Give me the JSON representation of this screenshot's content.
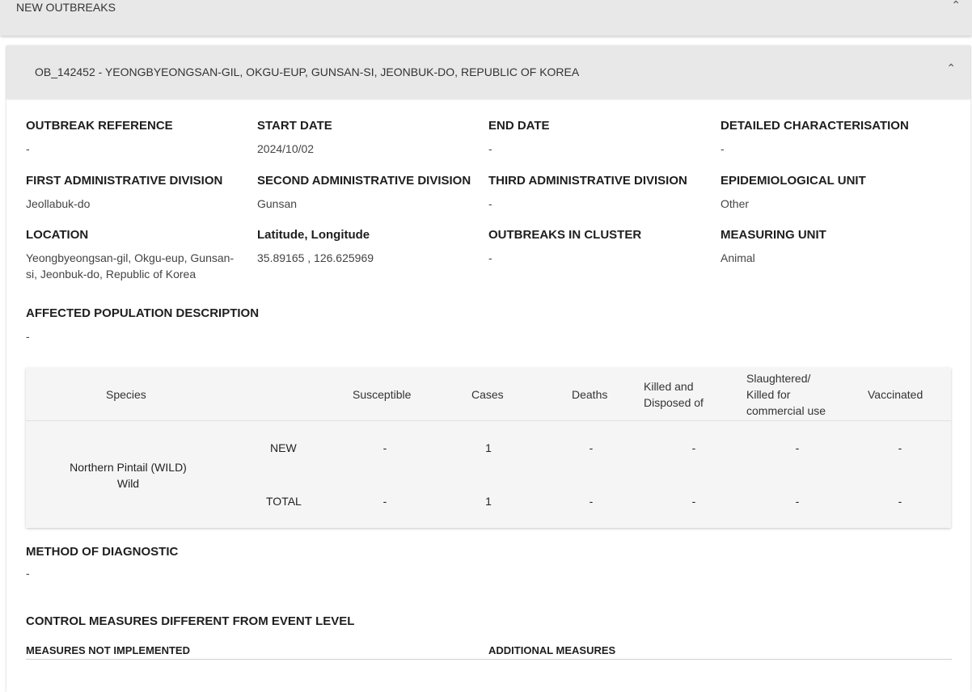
{
  "top_panel": {
    "title": "NEW OUTBREAKS",
    "toggle_icon": "chevron-up-icon"
  },
  "outbreak_panel": {
    "title": "OB_142452 - YEONGBYEONGSAN-GIL, OKGU-EUP, GUNSAN-SI, JEONBUK-DO, REPUBLIC OF KOREA",
    "toggle_icon": "chevron-up-icon"
  },
  "fields": {
    "outbreak_reference": {
      "label": "OUTBREAK REFERENCE",
      "value": "-"
    },
    "start_date": {
      "label": "START DATE",
      "value": "2024/10/02"
    },
    "end_date": {
      "label": "END DATE",
      "value": "-"
    },
    "detailed_characterisation": {
      "label": "DETAILED CHARACTERISATION",
      "value": "-"
    },
    "first_admin_division": {
      "label": "FIRST ADMINISTRATIVE DIVISION",
      "value": "Jeollabuk-do"
    },
    "second_admin_division": {
      "label": "SECOND ADMINISTRATIVE DIVISION",
      "value": "Gunsan"
    },
    "third_admin_division": {
      "label": "THIRD ADMINISTRATIVE DIVISION",
      "value": "-"
    },
    "epidemiological_unit": {
      "label": "EPIDEMIOLOGICAL UNIT",
      "value": "Other"
    },
    "location": {
      "label": "LOCATION",
      "value": "Yeongbyeongsan-gil, Okgu-eup, Gunsan-si, Jeonbuk-do, Republic of Korea"
    },
    "lat_long": {
      "label": "Latitude, Longitude",
      "value": "35.89165 , 126.625969"
    },
    "outbreaks_in_cluster": {
      "label": "OUTBREAKS IN CLUSTER",
      "value": "-"
    },
    "measuring_unit": {
      "label": "MEASURING UNIT",
      "value": "Animal"
    },
    "affected_population_description": {
      "label": "AFFECTED POPULATION DESCRIPTION",
      "value": "-"
    }
  },
  "species_table": {
    "headers": {
      "species": "Species",
      "susceptible": "Susceptible",
      "cases": "Cases",
      "deaths": "Deaths",
      "killed_disposed_line1": "Killed and",
      "killed_disposed_line2": "Disposed of",
      "slaughtered_line1": "Slaughtered/",
      "slaughtered_line2": "Killed for",
      "slaughtered_line3": "commercial use",
      "vaccinated": "Vaccinated"
    },
    "species_name": "Northern Pintail (WILD)",
    "species_type": "Wild",
    "rows": [
      {
        "label": "NEW",
        "susceptible": "-",
        "cases": "1",
        "deaths": "-",
        "killed_disposed": "-",
        "slaughtered": "-",
        "vaccinated": "-"
      },
      {
        "label": "TOTAL",
        "susceptible": "-",
        "cases": "1",
        "deaths": "-",
        "killed_disposed": "-",
        "slaughtered": "-",
        "vaccinated": "-"
      }
    ]
  },
  "method_of_diagnostic": {
    "label": "METHOD OF DIAGNOSTIC",
    "value": "-"
  },
  "control_measures": {
    "label": "CONTROL MEASURES DIFFERENT FROM EVENT LEVEL",
    "not_implemented_label": "MEASURES NOT IMPLEMENTED",
    "additional_label": "ADDITIONAL MEASURES"
  }
}
